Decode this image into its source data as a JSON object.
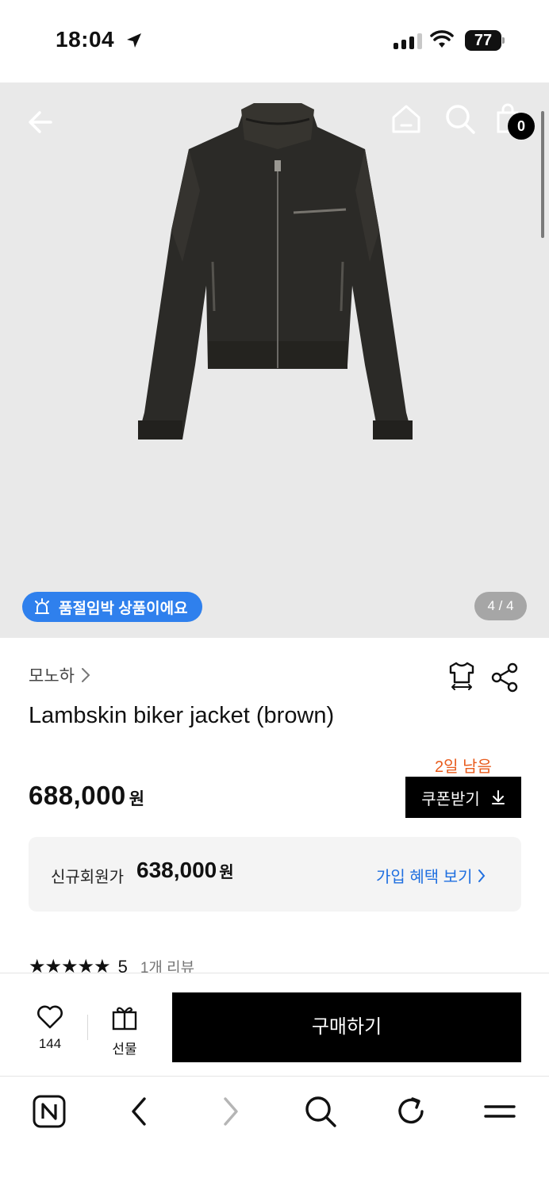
{
  "status_bar": {
    "time": "18:04",
    "battery": "77"
  },
  "header": {
    "cart_count": "0"
  },
  "hero": {
    "soldout_badge": "품절임박 상품이에요",
    "page_counter": "4 / 4"
  },
  "product": {
    "brand": "모노하",
    "title": "Lambskin biker jacket (brown)",
    "price": "688,000",
    "price_unit": "원",
    "coupon_remaining": "2일 남음",
    "coupon_button": "쿠폰받기",
    "member_label": "신규회원가",
    "member_price": "638,000",
    "member_price_unit": "원",
    "member_link": "가입 혜택 보기",
    "rating": "5",
    "review_count": "1개 리뷰",
    "rating_fraction": 1.0
  },
  "buy_bar": {
    "like_count": "144",
    "gift_label": "선물",
    "purchase_label": "구매하기"
  },
  "colors": {
    "accent_blue": "#2f80ed",
    "coupon_orange": "#e85b1c",
    "link_blue": "#1f6fe0"
  }
}
